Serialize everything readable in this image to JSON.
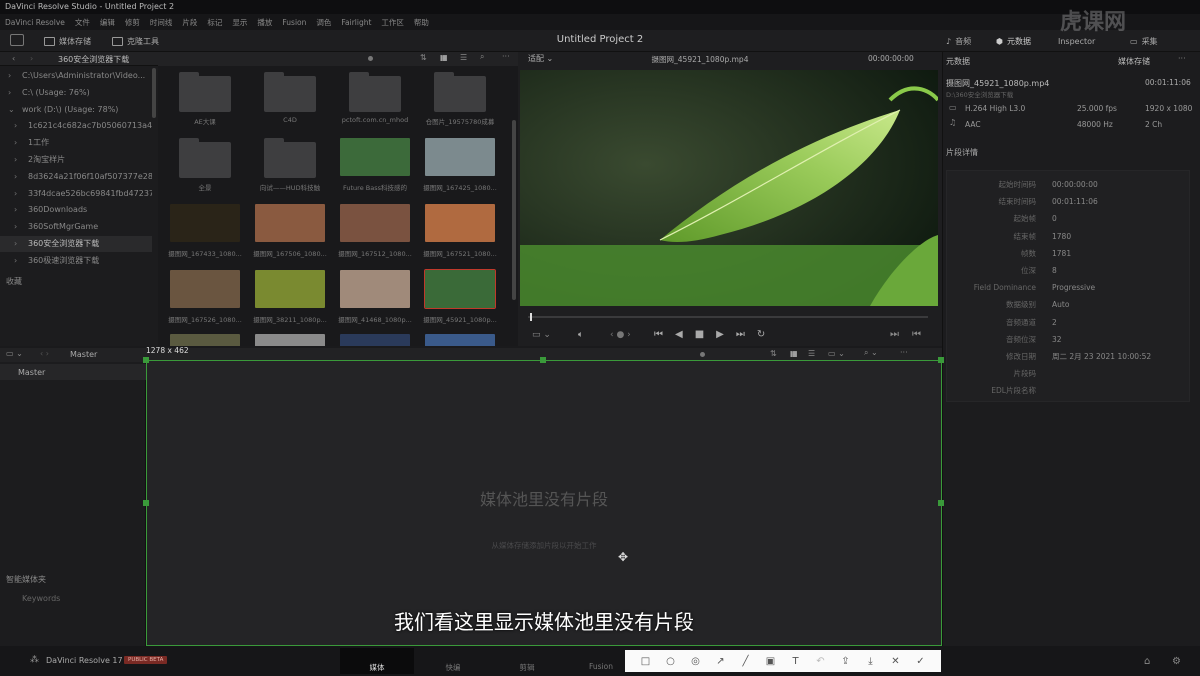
{
  "window": {
    "title": "DaVinci Resolve Studio - Untitled Project 2"
  },
  "menu": [
    "DaVinci Resolve",
    "文件",
    "编辑",
    "修剪",
    "时间线",
    "片段",
    "标记",
    "显示",
    "播放",
    "Fusion",
    "调色",
    "Fairlight",
    "工作区",
    "帮助"
  ],
  "toolbar": {
    "media_pool": "媒体存储",
    "clone_tool": "克隆工具",
    "project_title": "Untitled Project 2",
    "audio": "音频",
    "metadata": "元数据",
    "inspector": "Inspector",
    "capture": "采集"
  },
  "browser": {
    "path": "360安全浏览器下载",
    "items": [
      {
        "label": "C:\\Users\\Administrator\\Video...",
        "arrow": "›"
      },
      {
        "label": "C:\\ (Usage: 76%)",
        "arrow": "›"
      },
      {
        "label": "work (D:\\) (Usage: 78%)",
        "arrow": "⌄"
      },
      {
        "label": "1c621c4c682ac7b05060713a44c...",
        "arrow": "›"
      },
      {
        "label": "1工作",
        "arrow": "›"
      },
      {
        "label": "2淘宝样片",
        "arrow": "›"
      },
      {
        "label": "8d3624a21f06f10af507377e28e...",
        "arrow": "›"
      },
      {
        "label": "33f4dcae526bc69841fbd47237e...",
        "arrow": "›"
      },
      {
        "label": "360Downloads",
        "arrow": "›"
      },
      {
        "label": "360SoftMgrGame",
        "arrow": "›"
      },
      {
        "label": "360安全浏览器下载",
        "arrow": "›"
      },
      {
        "label": "360极速浏览器下载",
        "arrow": "›"
      }
    ],
    "favorites": "收藏"
  },
  "grid": {
    "folders": [
      {
        "label": "AE大课"
      },
      {
        "label": "C4D"
      },
      {
        "label": "pctoft.com.cn_mhod"
      },
      {
        "label": "仓图片_19575780成募"
      },
      {
        "label": "全景"
      },
      {
        "label": "向试——HUD科技触"
      }
    ],
    "clips": [
      {
        "label": "Future Bass科技感的",
        "color": "#3c6a3a"
      },
      {
        "label": "摄图网_167425_1080...",
        "color": "#7c8a8e"
      },
      {
        "label": "摄图网_167433_1080...",
        "color": "#2a2418"
      },
      {
        "label": "摄图网_167506_1080...",
        "color": "#8a5a40"
      },
      {
        "label": "摄图网_167512_1080...",
        "color": "#7a5240"
      },
      {
        "label": "摄图网_167521_1080...",
        "color": "#b06a40"
      },
      {
        "label": "摄图网_167526_1080...",
        "color": "#6a5540"
      },
      {
        "label": "摄图网_38211_1080p...",
        "color": "#7a8a30"
      },
      {
        "label": "摄图网_41468_1080p...",
        "color": "#a08a7a"
      },
      {
        "label": "摄图网_45921_1080p...",
        "color": "#3a6a38"
      }
    ]
  },
  "viewer": {
    "fit": "适配",
    "clip_name": "摄图网_45921_1080p.mp4",
    "timecode": "00:00:00:00"
  },
  "metadata_panel": {
    "tab_meta": "元数据",
    "tab_store": "媒体存储",
    "clip": "摄图网_45921_1080p.mp4",
    "path": "D:\\360安全浏览器下载",
    "duration": "00:01:11:06",
    "codec": "H.264 High L3.0",
    "fps": "25.000 fps",
    "resolution": "1920 x 1080",
    "audio_codec": "AAC",
    "sample_rate": "48000 Hz",
    "channels": "2 Ch",
    "section": "片段详情",
    "rows": [
      {
        "k": "起始时间码",
        "v": "00:00:00:00"
      },
      {
        "k": "结束时间码",
        "v": "00:01:11:06"
      },
      {
        "k": "起始帧",
        "v": "0"
      },
      {
        "k": "结束帧",
        "v": "1780"
      },
      {
        "k": "帧数",
        "v": "1781"
      },
      {
        "k": "位深",
        "v": "8"
      },
      {
        "k": "Field Dominance",
        "v": "Progressive"
      },
      {
        "k": "数据级别",
        "v": "Auto"
      },
      {
        "k": "音频通道",
        "v": "2"
      },
      {
        "k": "音频位深",
        "v": "32"
      },
      {
        "k": "修改日期",
        "v": "周二 2月 23 2021 10:00:52"
      },
      {
        "k": "片段码",
        "v": ""
      },
      {
        "k": "EDL片段名称",
        "v": ""
      }
    ]
  },
  "pool": {
    "master_label": "Master",
    "bin": "Master",
    "size_label": "1278 x 462",
    "empty_title": "媒体池里没有片段",
    "empty_hint": "从媒体存储添加片段以开始工作",
    "smart_bins": "智能媒体夹",
    "keywords": "Keywords"
  },
  "subtitle": "我们看这里显示媒体池里没有片段",
  "bottom": {
    "app": "DaVinci Resolve 17",
    "badge": "PUBLIC BETA",
    "pages": [
      "媒体",
      "快编",
      "剪辑",
      "Fusion"
    ]
  },
  "watermark": "虎课网",
  "colors": {
    "accent": "#3a9a3a",
    "badge": "#c0392b"
  }
}
